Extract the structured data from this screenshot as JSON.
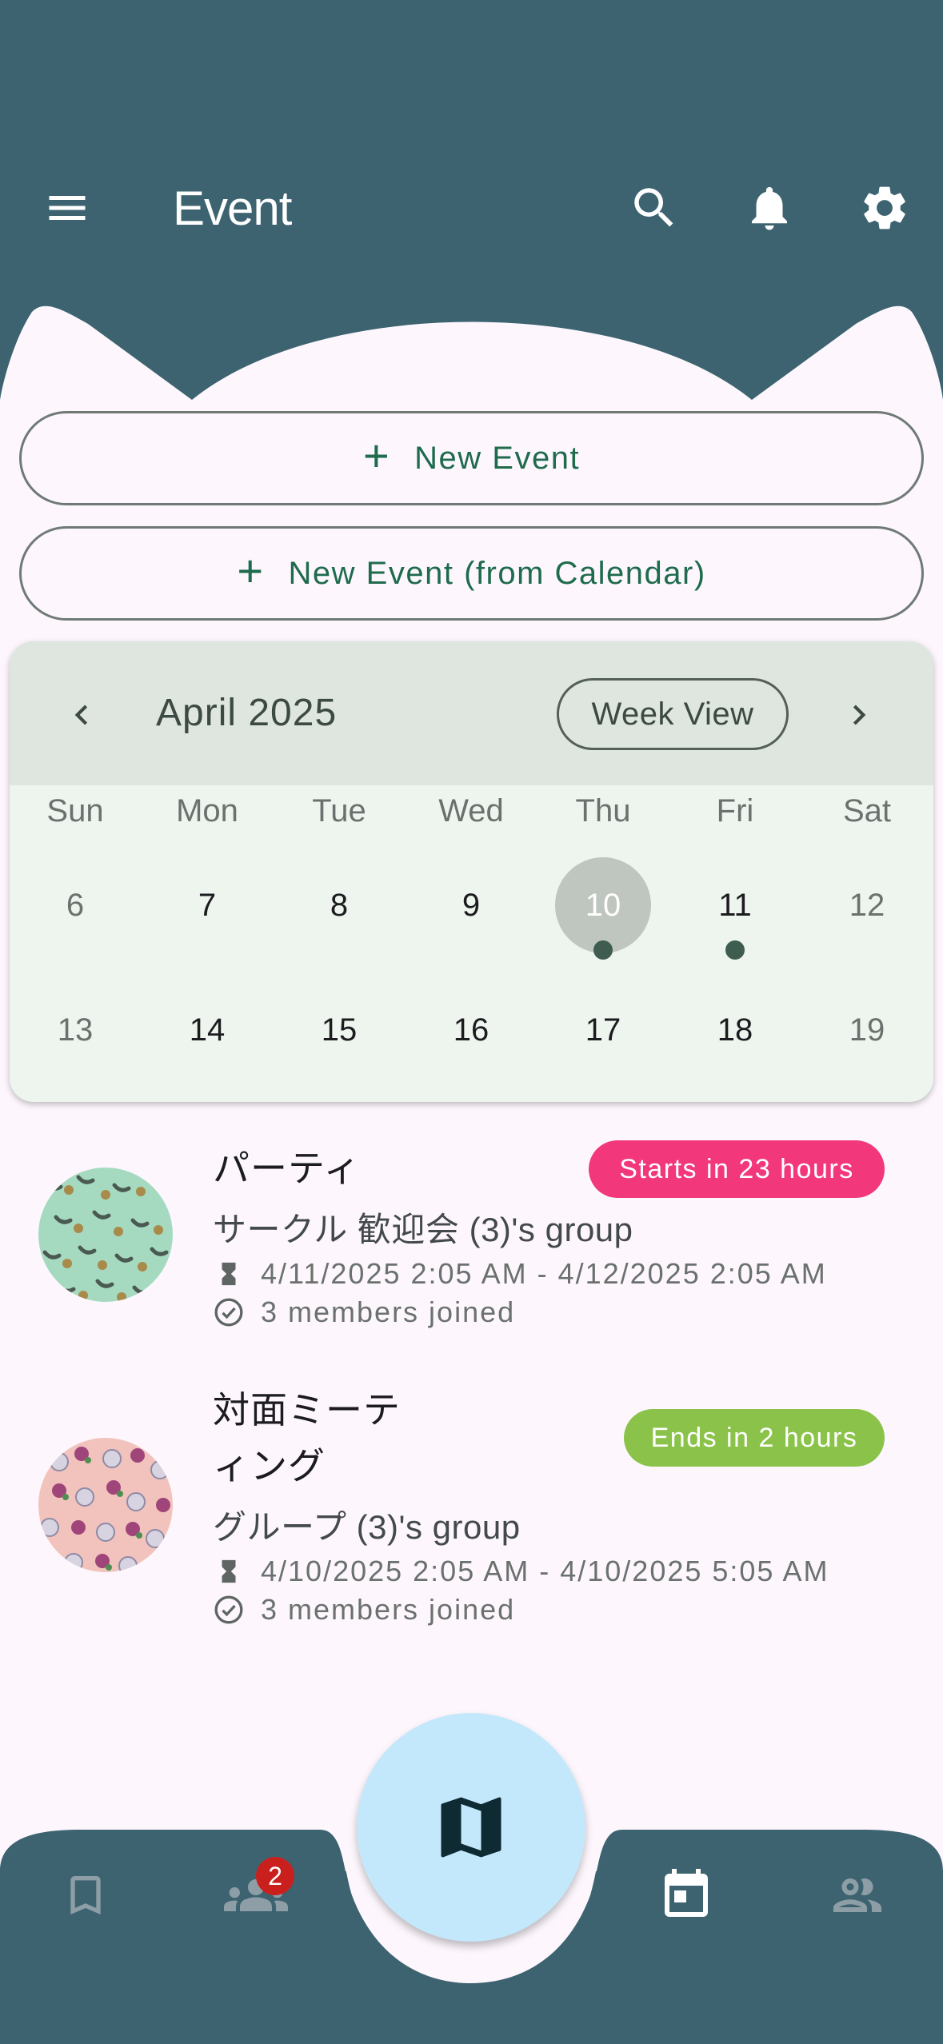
{
  "app_bar": {
    "title": "Event",
    "icons": [
      "menu-icon",
      "search-icon",
      "bell-icon",
      "gear-icon"
    ]
  },
  "actions": {
    "new_event": "New Event",
    "new_event_calendar": "New Event (from Calendar)"
  },
  "calendar": {
    "month": "April 2025",
    "view_toggle": "Week View",
    "weekdays": [
      "Sun",
      "Mon",
      "Tue",
      "Wed",
      "Thu",
      "Fri",
      "Sat"
    ],
    "weeks": [
      [
        "6",
        "7",
        "8",
        "9",
        "10",
        "11",
        "12"
      ],
      [
        "13",
        "14",
        "15",
        "16",
        "17",
        "18",
        "19"
      ]
    ],
    "today": "10",
    "event_days": [
      "10",
      "11"
    ]
  },
  "events": [
    {
      "title_line1": "パーティ",
      "title_line2": "",
      "group": "サークル 歓迎会  (3)'s group",
      "time": "4/11/2025 2:05 AM - 4/12/2025 2:05 AM",
      "members": "3 members joined",
      "badge": "Starts in 23 hours",
      "badge_color": "#F2377B"
    },
    {
      "title_line1": "対面ミーテ",
      "title_line2": "ィング",
      "group": "グループ  (3)'s group",
      "time": "4/10/2025 2:05 AM - 4/10/2025 5:05 AM",
      "members": "3 members joined",
      "badge": "Ends in 2 hours",
      "badge_color": "#8BC34A"
    }
  ],
  "bottom_nav": {
    "friends_badge": "2",
    "items": [
      "bookmark-icon",
      "friends-icon",
      "map-icon",
      "calendar-icon",
      "people-icon"
    ]
  },
  "colors": {
    "primary_dark": "#3D6371",
    "background": "#FDF7FD",
    "accent_text": "#1F6B4D"
  }
}
